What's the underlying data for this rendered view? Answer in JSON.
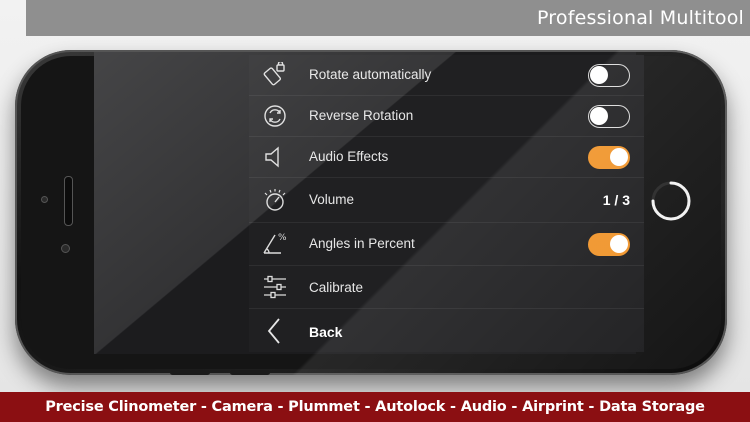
{
  "banner": {
    "title": "Professional Multitool"
  },
  "settings": {
    "rows": [
      {
        "label": "Rotate automatically",
        "icon": "rotate-screen-icon",
        "control": "toggle",
        "on": false
      },
      {
        "label": "Reverse Rotation",
        "icon": "reverse-rotation-icon",
        "control": "toggle",
        "on": false
      },
      {
        "label": "Audio Effects",
        "icon": "speaker-icon",
        "control": "toggle",
        "on": true
      },
      {
        "label": "Volume",
        "icon": "volume-dial-icon",
        "control": "value",
        "value": "1 / 3"
      },
      {
        "label": "Angles in Percent",
        "icon": "angle-percent-icon",
        "control": "toggle",
        "on": true
      },
      {
        "label": "Calibrate",
        "icon": "sliders-icon",
        "control": "none"
      }
    ],
    "back": {
      "label": "Back",
      "icon": "chevron-left-icon"
    }
  },
  "features": "Precise Clinometer - Camera - Plummet - Autolock - Audio - Airprint - Data Storage",
  "colors": {
    "accent": "#f0952c",
    "banner_red": "#8b0f12",
    "banner_grey": "#8f8f8f"
  }
}
